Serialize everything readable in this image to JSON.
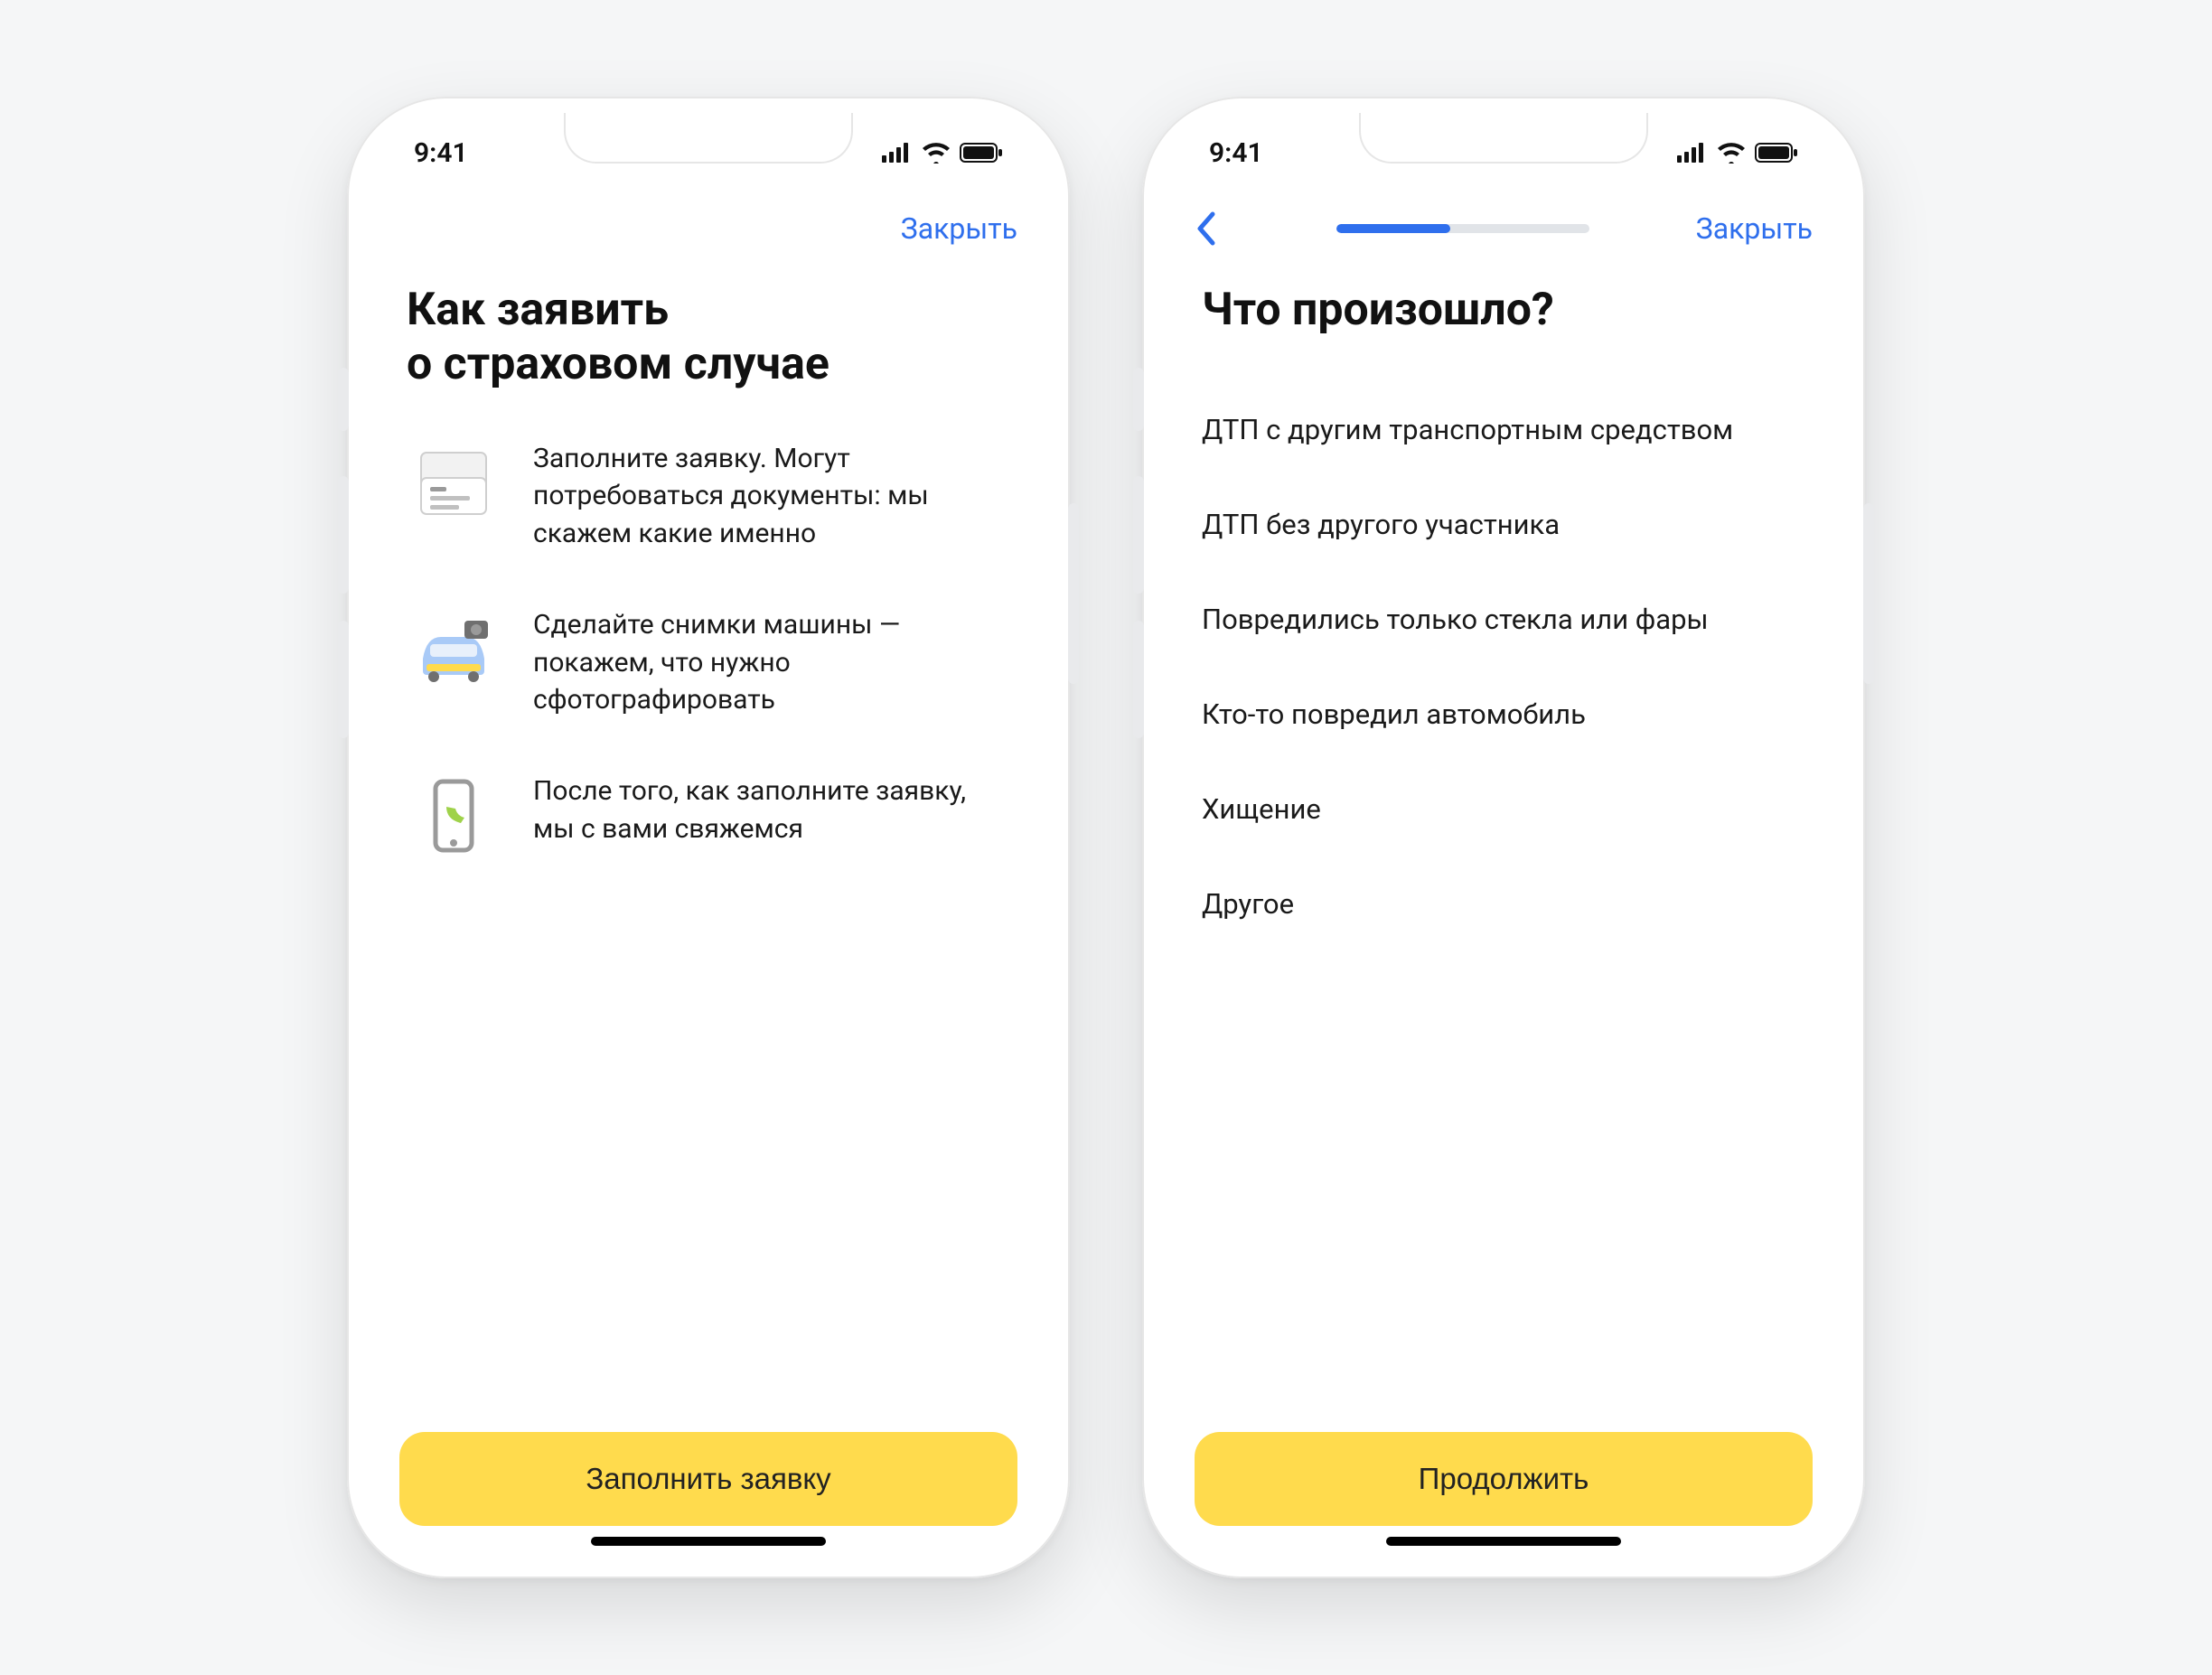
{
  "status": {
    "time": "9:41"
  },
  "nav": {
    "close": "Закрыть"
  },
  "screen1": {
    "title_line1": "Как заявить",
    "title_line2": "о страховом случае",
    "steps": [
      {
        "icon": "document-icon",
        "text": "Заполните заявку. Могут потребоваться документы: мы скажем какие именно"
      },
      {
        "icon": "car-photo-icon",
        "text": "Сделайте снимки машины — покажем, что нужно сфотографировать"
      },
      {
        "icon": "phone-call-icon",
        "text": "После того, как заполните заявку, мы с вами свяжемся"
      }
    ],
    "cta": "Заполнить заявку"
  },
  "screen2": {
    "title": "Что произошло?",
    "progress_percent": 45,
    "options": [
      "ДТП с другим транспортным средством",
      "ДТП без другого участника",
      "Повредились только стекла или фары",
      "Кто-то повредил автомобиль",
      "Хищение",
      "Другое"
    ],
    "cta": "Продолжить"
  },
  "colors": {
    "accent": "#2f6fed",
    "primary_btn": "#ffdb4d"
  }
}
